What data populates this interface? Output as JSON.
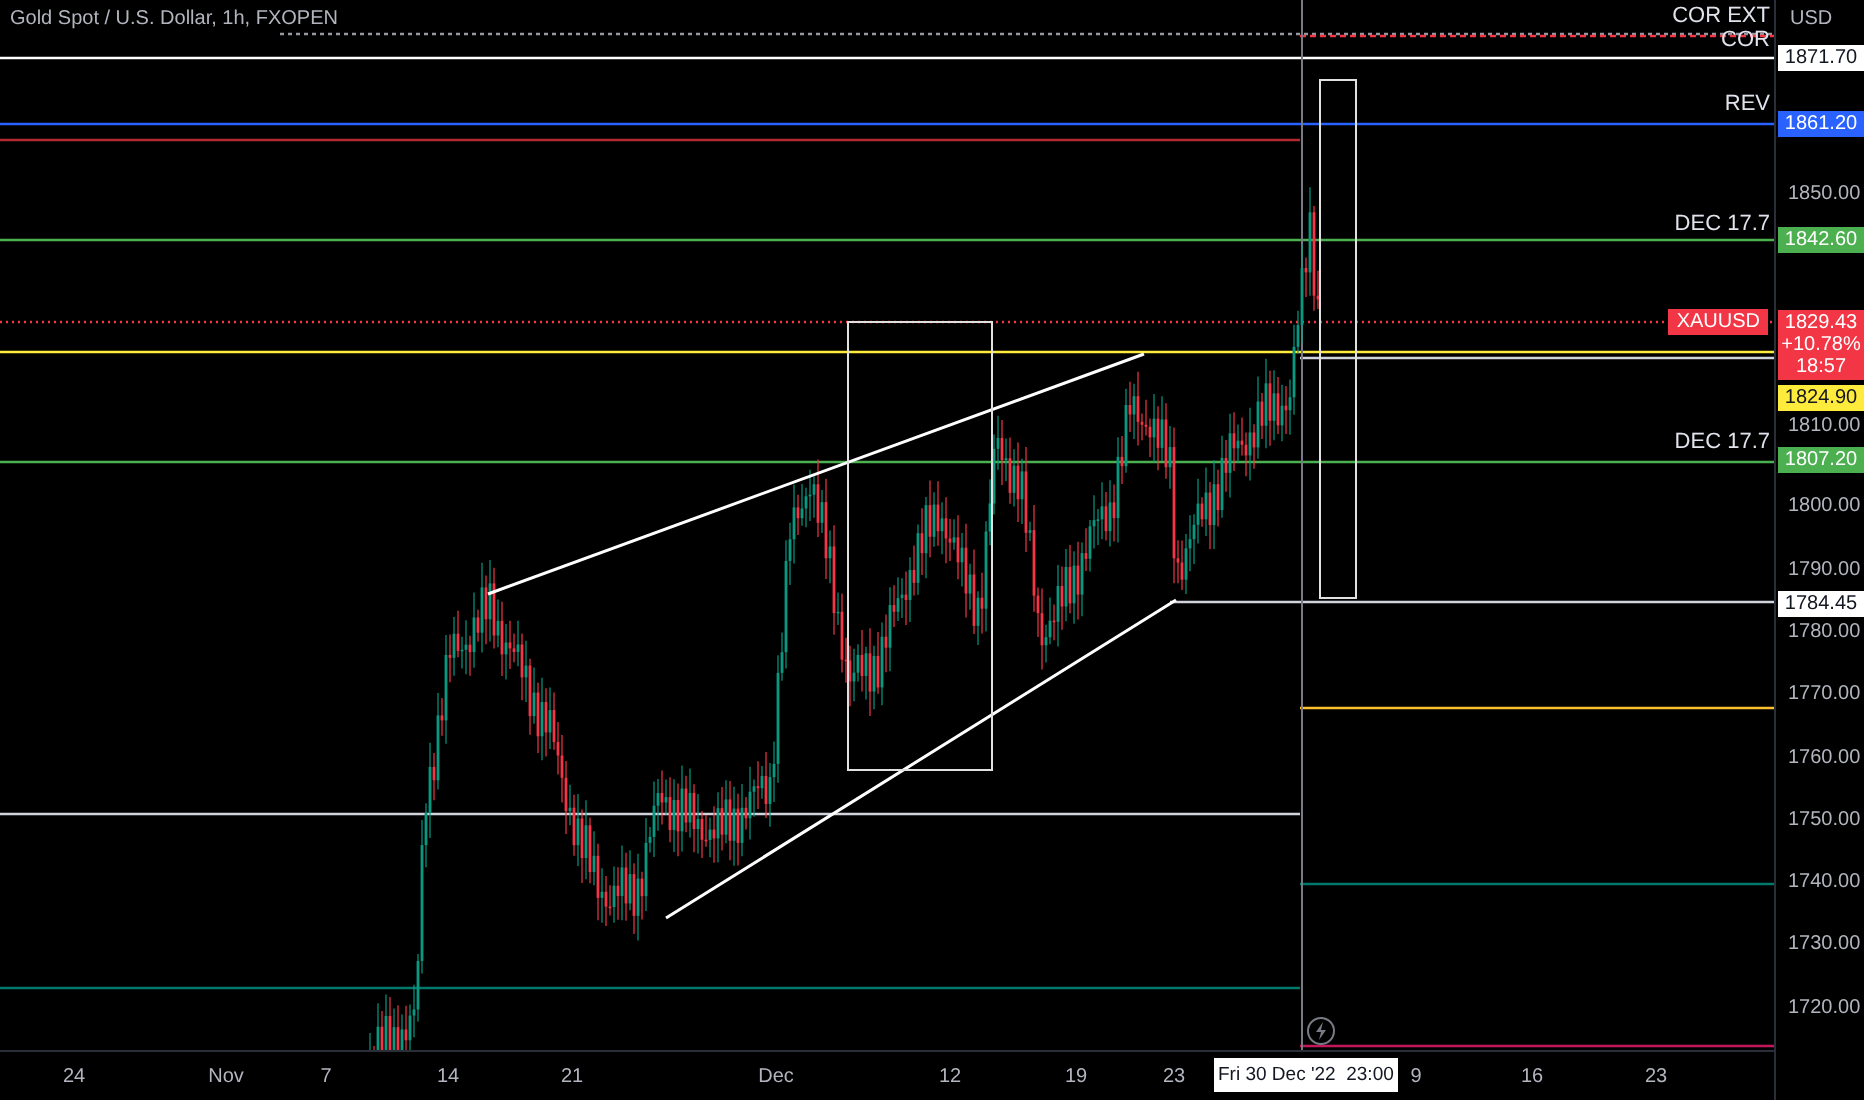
{
  "chart_title": "Gold Spot / U.S. Dollar, 1h, FXOPEN",
  "currency": "USD",
  "line_labels": [
    {
      "text": "COR EXT"
    },
    {
      "text": "COR"
    },
    {
      "text": "REV"
    },
    {
      "text": "DEC 17.7"
    },
    {
      "text": "DEC 17.7"
    }
  ],
  "symbol_tag": "XAUUSD",
  "price_tags": [
    {
      "text": "1871.70",
      "color": "#ffffff"
    },
    {
      "text": "1861.20",
      "color": "#2962ff"
    },
    {
      "text": "1842.60",
      "color": "#4caf50"
    },
    {
      "text": "1824.90",
      "color": "#ffeb3b"
    },
    {
      "text": "1807.20",
      "color": "#4caf50"
    },
    {
      "text": "1784.45",
      "color": "#ffffff"
    }
  ],
  "last_price": {
    "price": "1829.43",
    "change": "+10.78%",
    "countdown": "18:57"
  },
  "price_ticks": [
    "1850.00",
    "1810.00",
    "1800.00",
    "1790.00",
    "1780.00",
    "1770.00",
    "1760.00",
    "1750.00",
    "1740.00",
    "1730.00",
    "1720.00"
  ],
  "time_ticks": [
    "24",
    "Nov",
    "7",
    "14",
    "21",
    "Dec",
    "12",
    "19",
    "23",
    "9",
    "16",
    "23"
  ],
  "current_time": "Fri 30 Dec '22  23:00"
}
